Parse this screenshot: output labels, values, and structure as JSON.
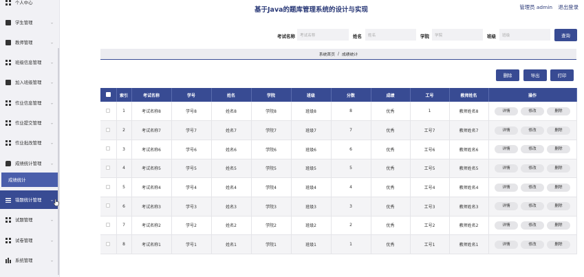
{
  "header": {
    "title": "基于Java的题库管理系统的设计与实现",
    "user_label": "管理员 admin",
    "logout_label": "退出登录"
  },
  "sidebar": {
    "items": [
      {
        "label": "个人中心",
        "icon": "grid-icon"
      },
      {
        "label": "学生管理",
        "icon": "user-icon"
      },
      {
        "label": "教师管理",
        "icon": "teacher-icon"
      },
      {
        "label": "班级信息管理",
        "icon": "grid-icon"
      },
      {
        "label": "加入班级管理",
        "icon": "square-icon"
      },
      {
        "label": "作业信息管理",
        "icon": "grid-icon"
      },
      {
        "label": "作业提交管理",
        "icon": "grid-icon"
      },
      {
        "label": "作业批改管理",
        "icon": "grid-icon"
      },
      {
        "label": "成绩统计管理",
        "icon": "chat-icon"
      },
      {
        "label": "错题统计管理",
        "icon": "list-icon"
      },
      {
        "label": "试题管理",
        "icon": "grid-icon"
      },
      {
        "label": "试卷管理",
        "icon": "grid-icon"
      },
      {
        "label": "系统管理",
        "icon": "bars-icon"
      }
    ],
    "sub_item": "成绩统计"
  },
  "search": {
    "exam_label": "考试名称",
    "exam_placeholder": "考试名称",
    "name_label": "姓名",
    "name_placeholder": "姓名",
    "college_label": "学院",
    "college_placeholder": "学院",
    "class_label": "班级",
    "class_placeholder": "班级",
    "query_button": "查询"
  },
  "breadcrumb": {
    "home": "系统首页",
    "separator": "/",
    "current": "成绩统计"
  },
  "toolbar": {
    "delete_label": "删除",
    "export_label": "导出",
    "print_label": "打印"
  },
  "table": {
    "headers": [
      "索引",
      "考试名称",
      "学号",
      "姓名",
      "学院",
      "班级",
      "分数",
      "成绩",
      "工号",
      "教师姓名",
      "操作"
    ],
    "rows": [
      {
        "index": "1",
        "exam": "考试名称8",
        "sid": "学号8",
        "name": "姓名8",
        "college": "学院8",
        "class": "班级8",
        "score": "8",
        "grade": "优秀",
        "work_no": "1",
        "teacher": "教师姓名8"
      },
      {
        "index": "2",
        "exam": "考试名称7",
        "sid": "学号7",
        "name": "姓名7",
        "college": "学院7",
        "class": "班级7",
        "score": "7",
        "grade": "优秀",
        "work_no": "工号7",
        "teacher": "教师姓名7"
      },
      {
        "index": "3",
        "exam": "考试名称6",
        "sid": "学号6",
        "name": "姓名6",
        "college": "学院6",
        "class": "班级6",
        "score": "6",
        "grade": "优秀",
        "work_no": "工号6",
        "teacher": "教师姓名6"
      },
      {
        "index": "4",
        "exam": "考试名称5",
        "sid": "学号5",
        "name": "姓名5",
        "college": "学院5",
        "class": "班级5",
        "score": "5",
        "grade": "优秀",
        "work_no": "工号5",
        "teacher": "教师姓名5"
      },
      {
        "index": "5",
        "exam": "考试名称4",
        "sid": "学号4",
        "name": "姓名4",
        "college": "学院4",
        "class": "班级4",
        "score": "4",
        "grade": "优秀",
        "work_no": "工号4",
        "teacher": "教师姓名4"
      },
      {
        "index": "6",
        "exam": "考试名称3",
        "sid": "学号3",
        "name": "姓名3",
        "college": "学院3",
        "class": "班级3",
        "score": "3",
        "grade": "优秀",
        "work_no": "工号3",
        "teacher": "教师姓名3"
      },
      {
        "index": "7",
        "exam": "考试名称2",
        "sid": "学号2",
        "name": "姓名2",
        "college": "学院2",
        "class": "班级2",
        "score": "2",
        "grade": "优秀",
        "work_no": "工号2",
        "teacher": "教师姓名2"
      },
      {
        "index": "8",
        "exam": "考试名称1",
        "sid": "学号1",
        "name": "姓名1",
        "college": "学院1",
        "class": "班级1",
        "score": "1",
        "grade": "优秀",
        "work_no": "工号1",
        "teacher": "教师姓名1"
      }
    ],
    "actions": {
      "detail": "详情",
      "edit": "修改",
      "delete": "删除"
    }
  },
  "colors": {
    "accent": "#384b93",
    "sidebar_bg": "#f1f1f5",
    "sub_item_bg": "#4a5eab"
  }
}
